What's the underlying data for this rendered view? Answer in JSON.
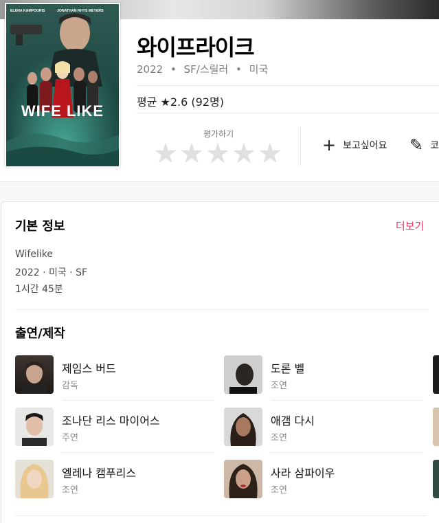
{
  "movie": {
    "title": "와이프라이크",
    "year": "2022",
    "sep": "•",
    "genre": "SF/스릴러",
    "country": "미국",
    "rating_text": "평균 ★2.6 (92명)",
    "poster": {
      "credit_left": "ELENA KAMPOURIS",
      "credit_right": "JONATHAN RHYS MEYERS",
      "logo": "WIFE LIKE"
    }
  },
  "rating_widget": {
    "label": "평가하기",
    "stars": [
      "★",
      "★",
      "★",
      "★",
      "★"
    ],
    "star_icon": "star-icon"
  },
  "actions": [
    {
      "icon": "plus-icon",
      "glyph": "+",
      "label": "보고싶어요"
    },
    {
      "icon": "pencil-icon",
      "glyph": "✎",
      "label": "코"
    }
  ],
  "basic_info": {
    "heading": "기본 정보",
    "more": "더보기",
    "original_title": "Wifelike",
    "line2": "2022 · 미국 · SF",
    "runtime": "1시간 45분"
  },
  "cast": {
    "heading": "출연/제작",
    "people": [
      {
        "name": "제임스 버드",
        "role": "감독"
      },
      {
        "name": "도론 벨",
        "role": "조연"
      },
      {
        "name": "조나단 리스 마이어스",
        "role": "주연"
      },
      {
        "name": "애갬 다시",
        "role": "조연"
      },
      {
        "name": "엘레나 캠푸리스",
        "role": "조연"
      },
      {
        "name": "사라 삼파이우",
        "role": "조연"
      }
    ]
  },
  "colors": {
    "accent": "#ff2f6e",
    "star_inactive": "#e0e0e0",
    "meta_gray": "#7e7e7e"
  }
}
